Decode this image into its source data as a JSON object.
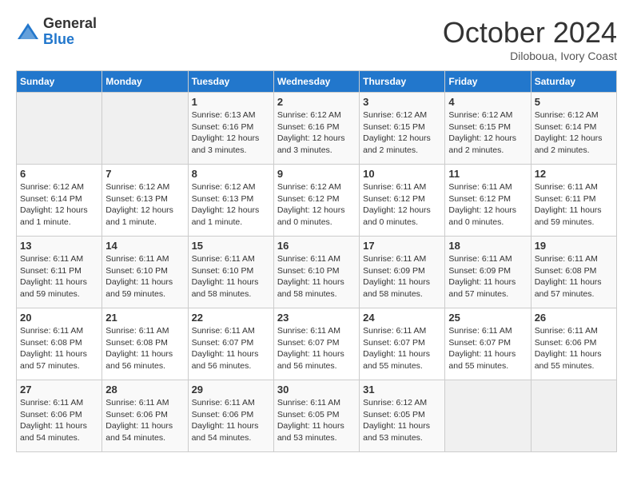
{
  "header": {
    "logo_general": "General",
    "logo_blue": "Blue",
    "month": "October 2024",
    "location": "Diloboua, Ivory Coast"
  },
  "days_of_week": [
    "Sunday",
    "Monday",
    "Tuesday",
    "Wednesday",
    "Thursday",
    "Friday",
    "Saturday"
  ],
  "weeks": [
    [
      {
        "day": "",
        "info": ""
      },
      {
        "day": "",
        "info": ""
      },
      {
        "day": "1",
        "info": "Sunrise: 6:13 AM\nSunset: 6:16 PM\nDaylight: 12 hours and 3 minutes."
      },
      {
        "day": "2",
        "info": "Sunrise: 6:12 AM\nSunset: 6:16 PM\nDaylight: 12 hours and 3 minutes."
      },
      {
        "day": "3",
        "info": "Sunrise: 6:12 AM\nSunset: 6:15 PM\nDaylight: 12 hours and 2 minutes."
      },
      {
        "day": "4",
        "info": "Sunrise: 6:12 AM\nSunset: 6:15 PM\nDaylight: 12 hours and 2 minutes."
      },
      {
        "day": "5",
        "info": "Sunrise: 6:12 AM\nSunset: 6:14 PM\nDaylight: 12 hours and 2 minutes."
      }
    ],
    [
      {
        "day": "6",
        "info": "Sunrise: 6:12 AM\nSunset: 6:14 PM\nDaylight: 12 hours and 1 minute."
      },
      {
        "day": "7",
        "info": "Sunrise: 6:12 AM\nSunset: 6:13 PM\nDaylight: 12 hours and 1 minute."
      },
      {
        "day": "8",
        "info": "Sunrise: 6:12 AM\nSunset: 6:13 PM\nDaylight: 12 hours and 1 minute."
      },
      {
        "day": "9",
        "info": "Sunrise: 6:12 AM\nSunset: 6:12 PM\nDaylight: 12 hours and 0 minutes."
      },
      {
        "day": "10",
        "info": "Sunrise: 6:11 AM\nSunset: 6:12 PM\nDaylight: 12 hours and 0 minutes."
      },
      {
        "day": "11",
        "info": "Sunrise: 6:11 AM\nSunset: 6:12 PM\nDaylight: 12 hours and 0 minutes."
      },
      {
        "day": "12",
        "info": "Sunrise: 6:11 AM\nSunset: 6:11 PM\nDaylight: 11 hours and 59 minutes."
      }
    ],
    [
      {
        "day": "13",
        "info": "Sunrise: 6:11 AM\nSunset: 6:11 PM\nDaylight: 11 hours and 59 minutes."
      },
      {
        "day": "14",
        "info": "Sunrise: 6:11 AM\nSunset: 6:10 PM\nDaylight: 11 hours and 59 minutes."
      },
      {
        "day": "15",
        "info": "Sunrise: 6:11 AM\nSunset: 6:10 PM\nDaylight: 11 hours and 58 minutes."
      },
      {
        "day": "16",
        "info": "Sunrise: 6:11 AM\nSunset: 6:10 PM\nDaylight: 11 hours and 58 minutes."
      },
      {
        "day": "17",
        "info": "Sunrise: 6:11 AM\nSunset: 6:09 PM\nDaylight: 11 hours and 58 minutes."
      },
      {
        "day": "18",
        "info": "Sunrise: 6:11 AM\nSunset: 6:09 PM\nDaylight: 11 hours and 57 minutes."
      },
      {
        "day": "19",
        "info": "Sunrise: 6:11 AM\nSunset: 6:08 PM\nDaylight: 11 hours and 57 minutes."
      }
    ],
    [
      {
        "day": "20",
        "info": "Sunrise: 6:11 AM\nSunset: 6:08 PM\nDaylight: 11 hours and 57 minutes."
      },
      {
        "day": "21",
        "info": "Sunrise: 6:11 AM\nSunset: 6:08 PM\nDaylight: 11 hours and 56 minutes."
      },
      {
        "day": "22",
        "info": "Sunrise: 6:11 AM\nSunset: 6:07 PM\nDaylight: 11 hours and 56 minutes."
      },
      {
        "day": "23",
        "info": "Sunrise: 6:11 AM\nSunset: 6:07 PM\nDaylight: 11 hours and 56 minutes."
      },
      {
        "day": "24",
        "info": "Sunrise: 6:11 AM\nSunset: 6:07 PM\nDaylight: 11 hours and 55 minutes."
      },
      {
        "day": "25",
        "info": "Sunrise: 6:11 AM\nSunset: 6:07 PM\nDaylight: 11 hours and 55 minutes."
      },
      {
        "day": "26",
        "info": "Sunrise: 6:11 AM\nSunset: 6:06 PM\nDaylight: 11 hours and 55 minutes."
      }
    ],
    [
      {
        "day": "27",
        "info": "Sunrise: 6:11 AM\nSunset: 6:06 PM\nDaylight: 11 hours and 54 minutes."
      },
      {
        "day": "28",
        "info": "Sunrise: 6:11 AM\nSunset: 6:06 PM\nDaylight: 11 hours and 54 minutes."
      },
      {
        "day": "29",
        "info": "Sunrise: 6:11 AM\nSunset: 6:06 PM\nDaylight: 11 hours and 54 minutes."
      },
      {
        "day": "30",
        "info": "Sunrise: 6:11 AM\nSunset: 6:05 PM\nDaylight: 11 hours and 53 minutes."
      },
      {
        "day": "31",
        "info": "Sunrise: 6:12 AM\nSunset: 6:05 PM\nDaylight: 11 hours and 53 minutes."
      },
      {
        "day": "",
        "info": ""
      },
      {
        "day": "",
        "info": ""
      }
    ]
  ]
}
